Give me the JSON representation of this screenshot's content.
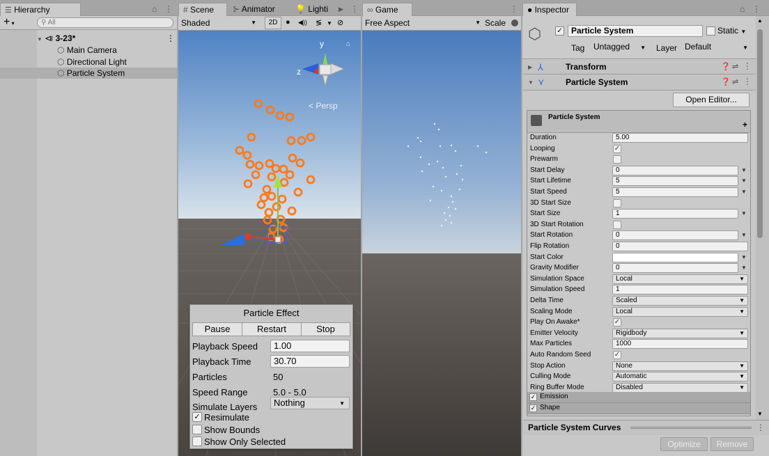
{
  "hierarchy": {
    "tab_label": "Hierarchy",
    "search_placeholder": "All",
    "add_label": "+",
    "scene_name": "3-23*",
    "items": [
      "Main Camera",
      "Directional Light",
      "Particle System"
    ],
    "selected_index": 2
  },
  "scene": {
    "tabs": [
      "Scene",
      "Animator",
      "Lighti"
    ],
    "shading_mode": "Shaded",
    "mode_2d": "2D",
    "axis_labels": {
      "y": "y",
      "z": "z"
    },
    "persp_label": "Persp"
  },
  "particle_effect": {
    "title": "Particle Effect",
    "buttons": [
      "Pause",
      "Restart",
      "Stop"
    ],
    "rows": [
      {
        "label": "Playback Speed",
        "value": "1.00",
        "editable": true
      },
      {
        "label": "Playback Time",
        "value": "30.70",
        "editable": true
      },
      {
        "label": "Particles",
        "value": "50",
        "editable": false
      },
      {
        "label": "Speed Range",
        "value": "5.0 - 5.0",
        "editable": false
      }
    ],
    "simulate_layers_label": "Simulate Layers",
    "simulate_layers_value": "Nothing",
    "checks": [
      {
        "label": "Resimulate",
        "checked": true
      },
      {
        "label": "Show Bounds",
        "checked": false
      },
      {
        "label": "Show Only Selected",
        "checked": false
      }
    ]
  },
  "game": {
    "tab_label": "Game",
    "aspect": "Free Aspect",
    "scale_label": "Scale"
  },
  "inspector": {
    "tab_label": "Inspector",
    "object_name": "Particle System",
    "static_label": "Static",
    "tag_label": "Tag",
    "tag_value": "Untagged",
    "layer_label": "Layer",
    "layer_value": "Default",
    "components": [
      "Transform",
      "Particle System"
    ],
    "open_editor": "Open Editor...",
    "module_title": "Particle System",
    "add_symbol": "+",
    "properties": [
      {
        "label": "Duration",
        "kind": "field",
        "value": "5.00"
      },
      {
        "label": "Looping",
        "kind": "check",
        "value": "✓"
      },
      {
        "label": "Prewarm",
        "kind": "check",
        "value": ""
      },
      {
        "label": "Start Delay",
        "kind": "field-arrow",
        "value": "0"
      },
      {
        "label": "Start Lifetime",
        "kind": "field-arrow",
        "value": "5"
      },
      {
        "label": "Start Speed",
        "kind": "field-arrow",
        "value": "5"
      },
      {
        "label": "3D Start Size",
        "kind": "check",
        "value": ""
      },
      {
        "label": "Start Size",
        "kind": "field-arrow",
        "value": "1"
      },
      {
        "label": "3D Start Rotation",
        "kind": "check",
        "value": ""
      },
      {
        "label": "Start Rotation",
        "kind": "field-arrow",
        "value": "0"
      },
      {
        "label": "Flip Rotation",
        "kind": "field",
        "value": "0"
      },
      {
        "label": "Start Color",
        "kind": "color-arrow",
        "value": ""
      },
      {
        "label": "Gravity Modifier",
        "kind": "field-arrow",
        "value": "0"
      },
      {
        "label": "Simulation Space",
        "kind": "dropdown",
        "value": "Local"
      },
      {
        "label": "Simulation Speed",
        "kind": "field",
        "value": "1"
      },
      {
        "label": "Delta Time",
        "kind": "dropdown",
        "value": "Scaled"
      },
      {
        "label": "Scaling Mode",
        "kind": "dropdown",
        "value": "Local"
      },
      {
        "label": "Play On Awake*",
        "kind": "check",
        "value": "✓"
      },
      {
        "label": "Emitter Velocity",
        "kind": "dropdown",
        "value": "Rigidbody"
      },
      {
        "label": "Max Particles",
        "kind": "field",
        "value": "1000"
      },
      {
        "label": "Auto Random Seed",
        "kind": "check",
        "value": "✓"
      },
      {
        "label": "Stop Action",
        "kind": "dropdown",
        "value": "None"
      },
      {
        "label": "Culling Mode",
        "kind": "dropdown",
        "value": "Automatic"
      },
      {
        "label": "Ring Buffer Mode",
        "kind": "dropdown",
        "value": "Disabled"
      }
    ],
    "modules": [
      "Emission",
      "Shape"
    ],
    "curves_label": "Particle System Curves",
    "optimize": "Optimize",
    "remove": "Remove"
  }
}
